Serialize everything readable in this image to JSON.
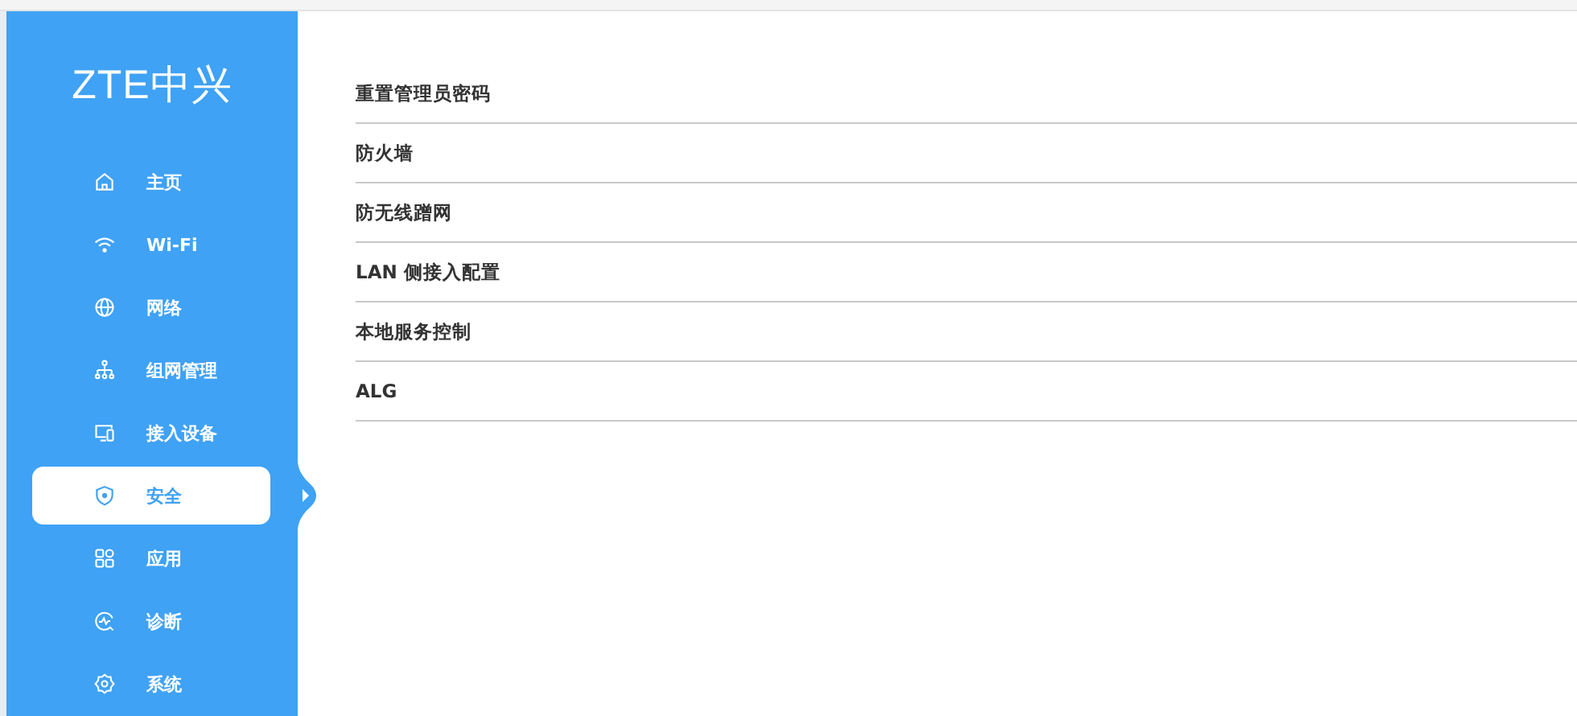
{
  "logo": "ZTE中兴",
  "sidebar": {
    "items": [
      {
        "label": "主页",
        "selected": false
      },
      {
        "label": "Wi-Fi",
        "selected": false
      },
      {
        "label": "网络",
        "selected": false
      },
      {
        "label": "组网管理",
        "selected": false
      },
      {
        "label": "接入设备",
        "selected": false
      },
      {
        "label": "安全",
        "selected": true
      },
      {
        "label": "应用",
        "selected": false
      },
      {
        "label": "诊断",
        "selected": false
      },
      {
        "label": "系统",
        "selected": false
      }
    ]
  },
  "menu": [
    "重置管理员密码",
    "防火墙",
    "防无线蹭网",
    "LAN 侧接入配置",
    "本地服务控制",
    "ALG"
  ]
}
